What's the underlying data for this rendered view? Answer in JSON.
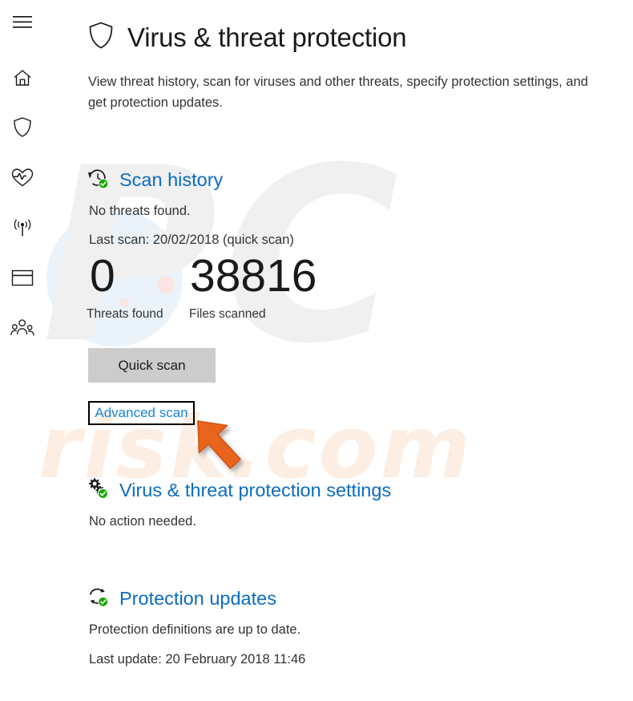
{
  "app": {
    "title": "Virus & threat protection",
    "description": "View threat history, scan for viruses and other threats, specify protection settings, and get protection updates.",
    "accent_blue": "#0b6cc0",
    "link_blue": "#1886d8",
    "status_green": "#14a800",
    "button_gray": "#cccccc",
    "highlight_orange": "#e8641c"
  },
  "sidebar": {
    "items": [
      {
        "name": "hamburger-menu",
        "icon": "hamburger-icon"
      },
      {
        "name": "home",
        "icon": "home-icon"
      },
      {
        "name": "virus-threat-protection",
        "icon": "shield-icon"
      },
      {
        "name": "device-performance-health",
        "icon": "heart-pulse-icon"
      },
      {
        "name": "firewall-network-protection",
        "icon": "wifi-signal-icon"
      },
      {
        "name": "app-browser-control",
        "icon": "app-window-icon"
      },
      {
        "name": "family-options",
        "icon": "family-people-icon"
      }
    ]
  },
  "sections": {
    "scan_history": {
      "title": "Scan history",
      "icon": "history-clock-check-icon",
      "status": "No threats found.",
      "last_scan": "Last scan: 20/02/2018 (quick scan)",
      "stats": [
        {
          "value": "0",
          "label": "Threats found"
        },
        {
          "value": "38816",
          "label": "Files scanned"
        }
      ],
      "quick_scan_button": "Quick scan",
      "advanced_scan_link": "Advanced scan"
    },
    "protection_settings": {
      "title": "Virus & threat protection settings",
      "icon": "gears-check-icon",
      "status": "No action needed."
    },
    "protection_updates": {
      "title": "Protection updates",
      "icon": "refresh-check-icon",
      "status": "Protection definitions are up to date.",
      "last_update": "Last update: 20 February 2018 11:46"
    }
  },
  "watermark": {
    "primary": "PC",
    "secondary": "risk.com"
  }
}
